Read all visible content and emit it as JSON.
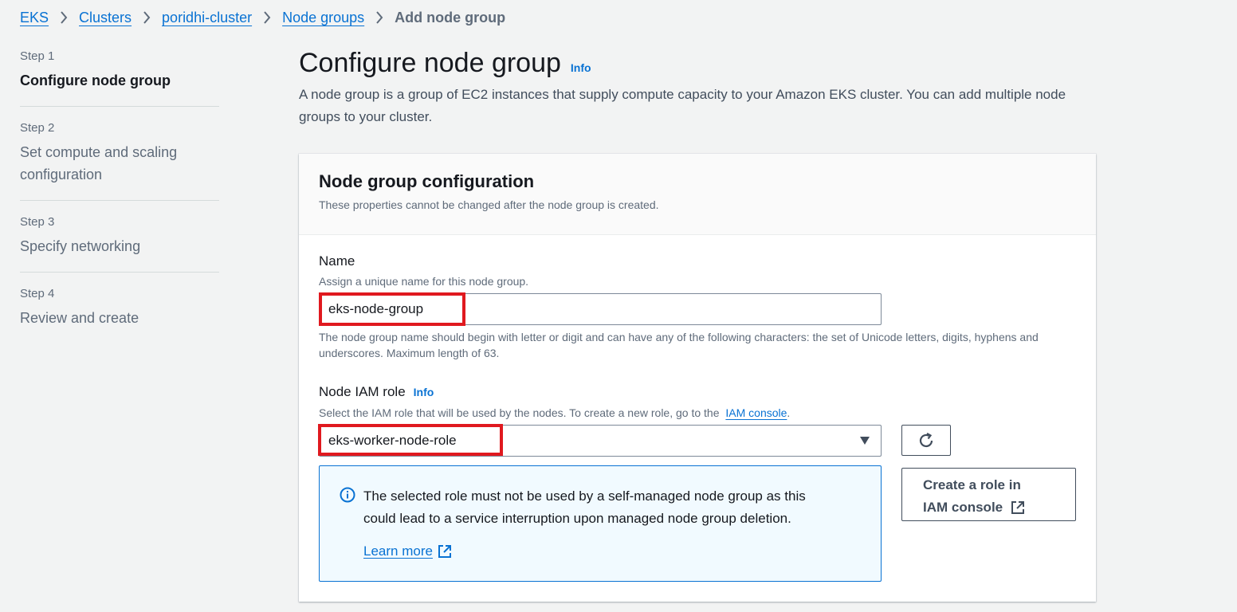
{
  "breadcrumb": {
    "items": [
      "EKS",
      "Clusters",
      "poridhi-cluster",
      "Node groups"
    ],
    "current": "Add node group"
  },
  "steps": [
    {
      "num": "Step 1",
      "title": "Configure node group",
      "active": true
    },
    {
      "num": "Step 2",
      "title": "Set compute and scaling configuration",
      "active": false
    },
    {
      "num": "Step 3",
      "title": "Specify networking",
      "active": false
    },
    {
      "num": "Step 4",
      "title": "Review and create",
      "active": false
    }
  ],
  "page": {
    "title": "Configure node group",
    "info": "Info",
    "description": "A node group is a group of EC2 instances that supply compute capacity to your Amazon EKS cluster. You can add multiple node groups to your cluster."
  },
  "panel": {
    "title": "Node group configuration",
    "subtitle": "These properties cannot be changed after the node group is created.",
    "name_field": {
      "label": "Name",
      "help": "Assign a unique name for this node group.",
      "value": "eks-node-group",
      "constraint": "The node group name should begin with letter or digit and can have any of the following characters: the set of Unicode letters, digits, hyphens and underscores. Maximum length of 63."
    },
    "role_field": {
      "label": "Node IAM role",
      "info": "Info",
      "help_prefix": "Select the IAM role that will be used by the nodes. To create a new role, go to the",
      "help_link": "IAM console",
      "help_suffix": ".",
      "value": "eks-worker-node-role",
      "create_role_line1": "Create a role in",
      "create_role_line2": "IAM console"
    },
    "alert": {
      "text": "The selected role must not be used by a self-managed node group as this could lead to a service interruption upon managed node group deletion.",
      "link": "Learn more"
    }
  },
  "colors": {
    "link": "#0972d3",
    "highlight": "#e0191f",
    "alert_bg": "#f1faff"
  }
}
